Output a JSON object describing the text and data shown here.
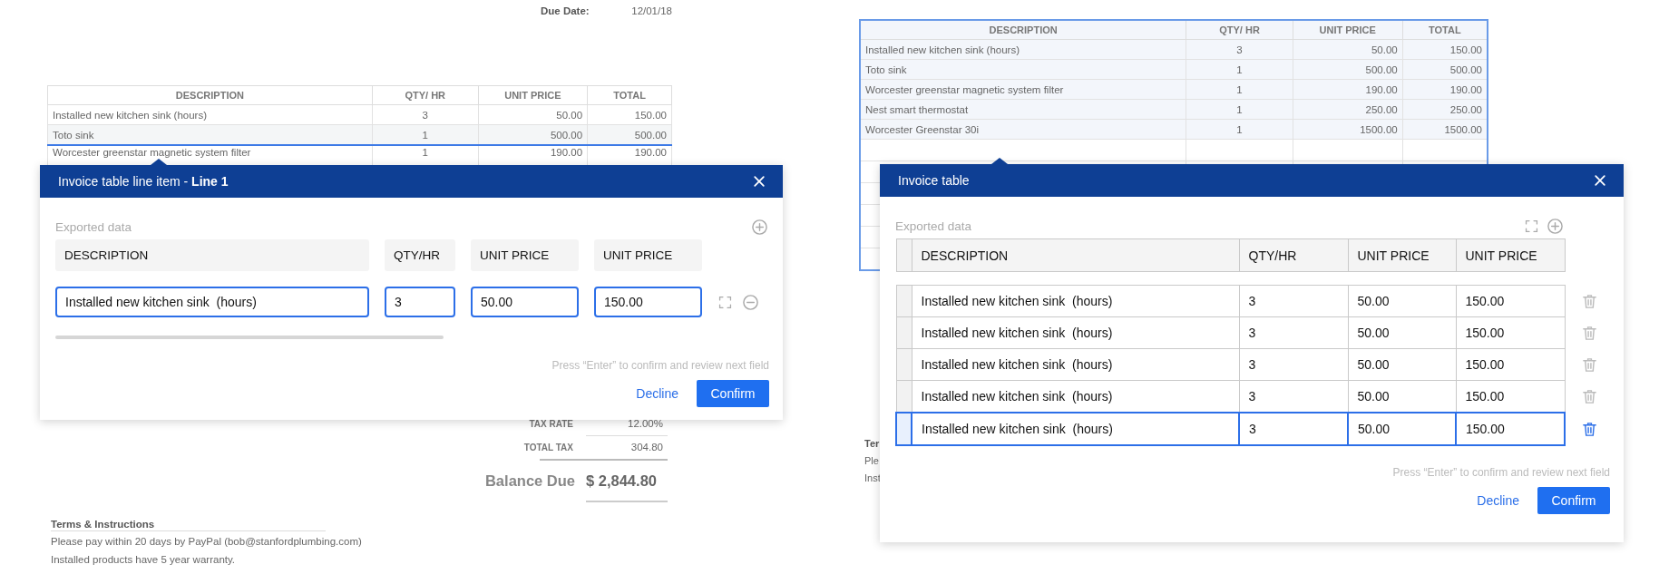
{
  "left_view": {
    "due_date": {
      "label": "Due Date:",
      "value": "12/01/18"
    },
    "invoice_table": {
      "selected": false,
      "columns": [
        "DESCRIPTION",
        "QTY/ HR",
        "UNIT PRICE",
        "TOTAL"
      ],
      "rows": [
        {
          "cells": [
            "Installed new kitchen sink (hours)",
            "3",
            "50.00",
            "150.00"
          ],
          "selected": false
        },
        {
          "cells": [
            "Toto sink",
            "1",
            "500.00",
            "500.00"
          ],
          "selected": true
        },
        {
          "cells": [
            "Worcester greenstar magnetic system filter",
            "1",
            "190.00",
            "190.00"
          ],
          "selected": false
        }
      ]
    },
    "totals": [
      {
        "label": "TAX RATE",
        "value": "12.00%"
      },
      {
        "label": "TOTAL TAX",
        "value": "304.80"
      }
    ],
    "balance_due": {
      "label": "Balance Due",
      "value": "$ 2,844.80"
    },
    "terms": {
      "heading": "Terms & Instructions",
      "lines": [
        "Please pay within 20 days by PayPal (bob@stanfordplumbing.com)",
        "Installed products have 5 year warranty."
      ]
    },
    "popup": {
      "kind": "line_item",
      "title": "Invoice table line item - **Line 1**",
      "section_label": "Exported data",
      "columns": [
        "DESCRIPTION",
        "QTY/HR",
        "UNIT PRICE",
        "UNIT PRICE"
      ],
      "values": [
        "Installed new kitchen sink  (hours)",
        "3",
        "50.00",
        "150.00"
      ],
      "hint": "Press “Enter” to confirm and review next field",
      "buttons": [
        {
          "label": "Decline",
          "kind": "link"
        },
        {
          "label": "Confirm",
          "kind": "primary"
        }
      ]
    }
  },
  "right_view": {
    "invoice_table": {
      "selected": true,
      "columns": [
        "DESCRIPTION",
        "QTY/ HR",
        "UNIT PRICE",
        "TOTAL"
      ],
      "rows": [
        {
          "cells": [
            "Installed new kitchen sink (hours)",
            "3",
            "50.00",
            "150.00"
          ],
          "selected": false
        },
        {
          "cells": [
            "Toto sink",
            "1",
            "500.00",
            "500.00"
          ],
          "selected": false
        },
        {
          "cells": [
            "Worcester greenstar magnetic system filter",
            "1",
            "190.00",
            "190.00"
          ],
          "selected": false
        },
        {
          "cells": [
            "Nest smart thermostat",
            "1",
            "250.00",
            "250.00"
          ],
          "selected": false
        },
        {
          "cells": [
            "Worcester Greenstar 30i",
            "1",
            "1500.00",
            "1500.00"
          ],
          "selected": false
        }
      ]
    },
    "terms_fragments": [
      "Ter",
      "Ple",
      "Inst"
    ],
    "popup": {
      "kind": "table",
      "title": "Invoice table",
      "section_label": "Exported data",
      "columns": [
        "DESCRIPTION",
        "QTY/HR",
        "UNIT PRICE",
        "UNIT PRICE"
      ],
      "rows": [
        {
          "cells": [
            "Installed new kitchen sink  (hours)",
            "3",
            "50.00",
            "150.00"
          ],
          "selected": false
        },
        {
          "cells": [
            "Installed new kitchen sink  (hours)",
            "3",
            "50.00",
            "150.00"
          ],
          "selected": false
        },
        {
          "cells": [
            "Installed new kitchen sink  (hours)",
            "3",
            "50.00",
            "150.00"
          ],
          "selected": false
        },
        {
          "cells": [
            "Installed new kitchen sink  (hours)",
            "3",
            "50.00",
            "150.00"
          ],
          "selected": false
        },
        {
          "cells": [
            "Installed new kitchen sink  (hours)",
            "3",
            "50.00",
            "150.00"
          ],
          "selected": true
        }
      ],
      "hint": "Press “Enter” to confirm and review next field",
      "buttons": [
        {
          "label": "Decline",
          "kind": "link"
        },
        {
          "label": "Confirm",
          "kind": "primary"
        }
      ]
    }
  }
}
